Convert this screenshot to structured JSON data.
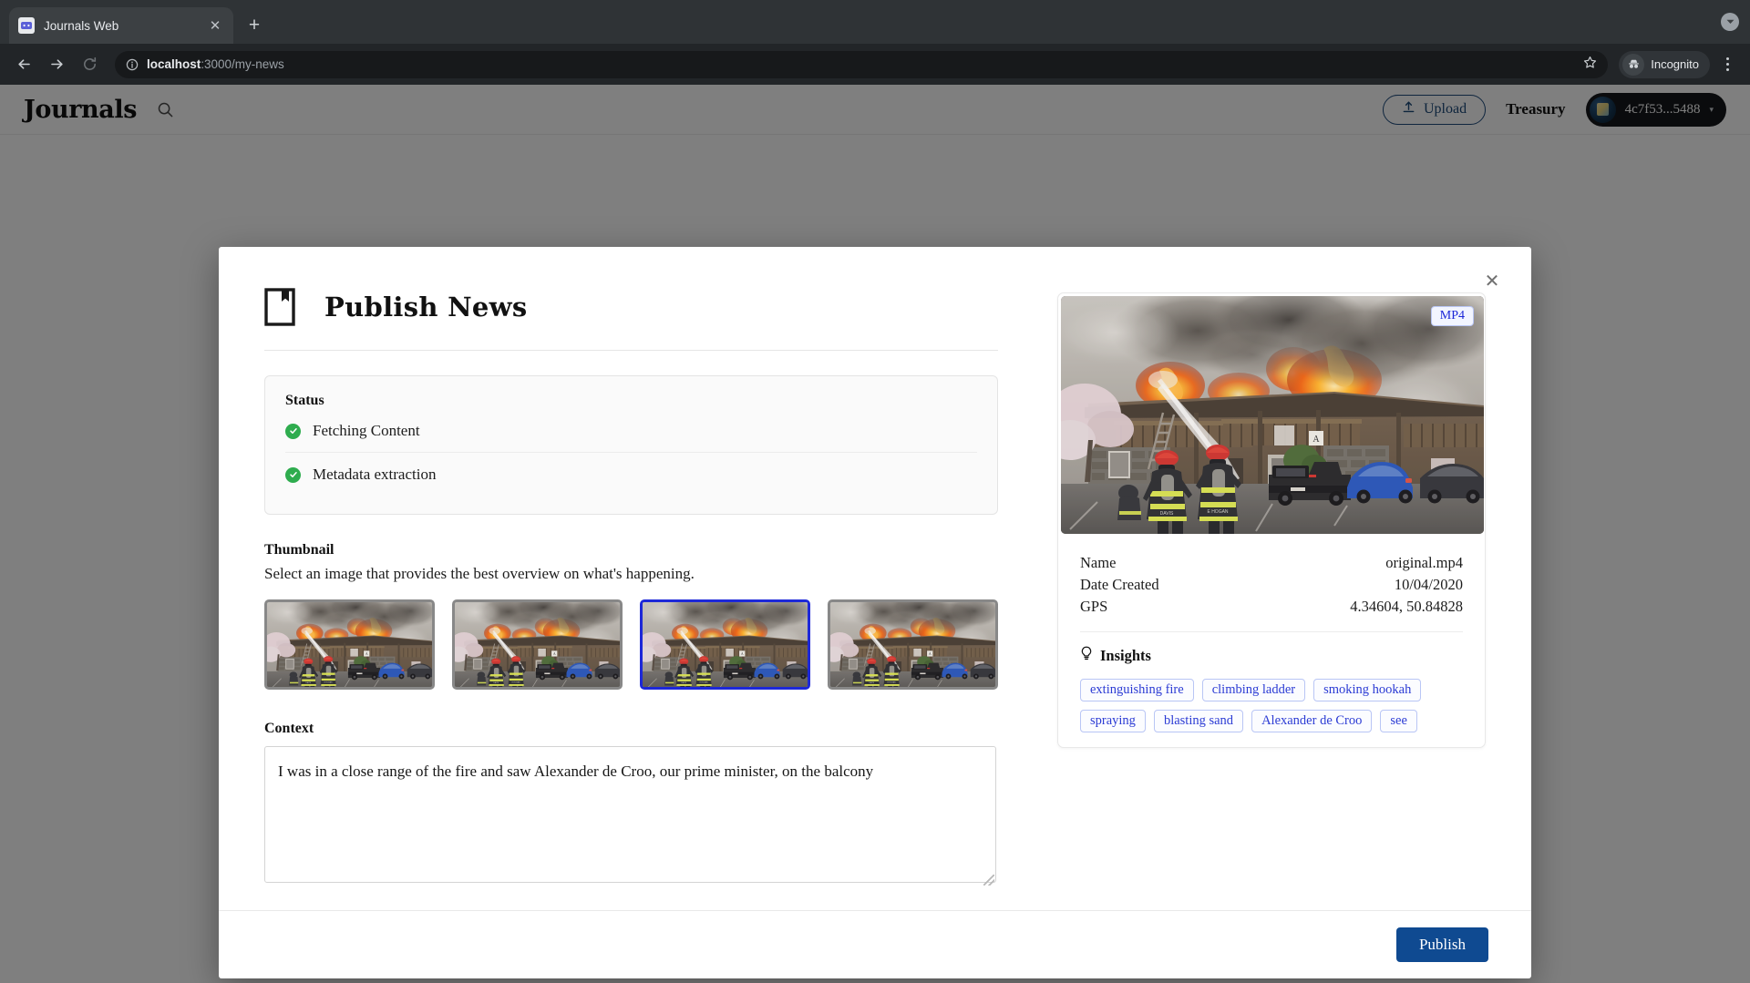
{
  "browser": {
    "tab": {
      "title": "Journals Web",
      "favicon_icon": "journals-favicon",
      "close_icon": "close-icon"
    },
    "new_tab_label": "+",
    "back_icon": "back-arrow-icon",
    "forward_icon": "forward-arrow-icon",
    "reload_icon": "reload-icon",
    "info_icon": "site-info-icon",
    "url_host": "localhost",
    "url_path": ":3000/my-news",
    "star_icon": "bookmark-star-icon",
    "profile_label": "Incognito",
    "menu_icon": "kebab-menu-icon",
    "tabstrip_chevron_icon": "chevron-down-icon"
  },
  "app_header": {
    "brand": "Journals",
    "search_icon": "search-icon",
    "upload_label": "Upload",
    "upload_icon": "upload-icon",
    "treasury_label": "Treasury",
    "wallet_address": "4c7f53...5488",
    "wallet_caret_icon": "chevron-down-icon",
    "wallet_avatar_icon": "wallet-avatar"
  },
  "modal": {
    "close_icon": "close-icon",
    "title": "Publish  News",
    "title_icon": "journal-book-icon",
    "status": {
      "heading": "Status",
      "items": [
        {
          "label": "Fetching Content",
          "icon": "check-circle-icon",
          "state": "done"
        },
        {
          "label": "Metadata extraction",
          "icon": "check-circle-icon",
          "state": "done"
        }
      ]
    },
    "thumbnail": {
      "label": "Thumbnail",
      "description": "Select an image that provides the best overview on what's happening.",
      "items": [
        {
          "name": "thumbnail-option-1",
          "selected": false
        },
        {
          "name": "thumbnail-option-2",
          "selected": false
        },
        {
          "name": "thumbnail-option-3",
          "selected": true
        },
        {
          "name": "thumbnail-option-4",
          "selected": false
        }
      ]
    },
    "context": {
      "label": "Context",
      "value": "I was in a close range of the fire and saw Alexander de Croo, our prime minister, on the balcony",
      "placeholder": ""
    },
    "media": {
      "badge": "MP4",
      "preview_alt": "firefighters spraying water on burning apartment building",
      "metadata": [
        {
          "key": "Name",
          "value": "original.mp4"
        },
        {
          "key": "Date Created",
          "value": "10/04/2020"
        },
        {
          "key": "GPS",
          "value": "4.34604, 50.84828"
        }
      ],
      "insights": {
        "heading": "Insights",
        "icon": "lightbulb-icon",
        "tags": [
          "extinguishing fire",
          "climbing ladder",
          "smoking hookah",
          "spraying",
          "blasting sand",
          "Alexander de Croo",
          "see"
        ]
      }
    },
    "footer": {
      "publish_label": "Publish"
    }
  },
  "colors": {
    "accent_blue": "#0f4a91",
    "selected_border": "#1d28d8",
    "tag_text": "#2b3bd4",
    "success_green": "#2eac4e"
  }
}
